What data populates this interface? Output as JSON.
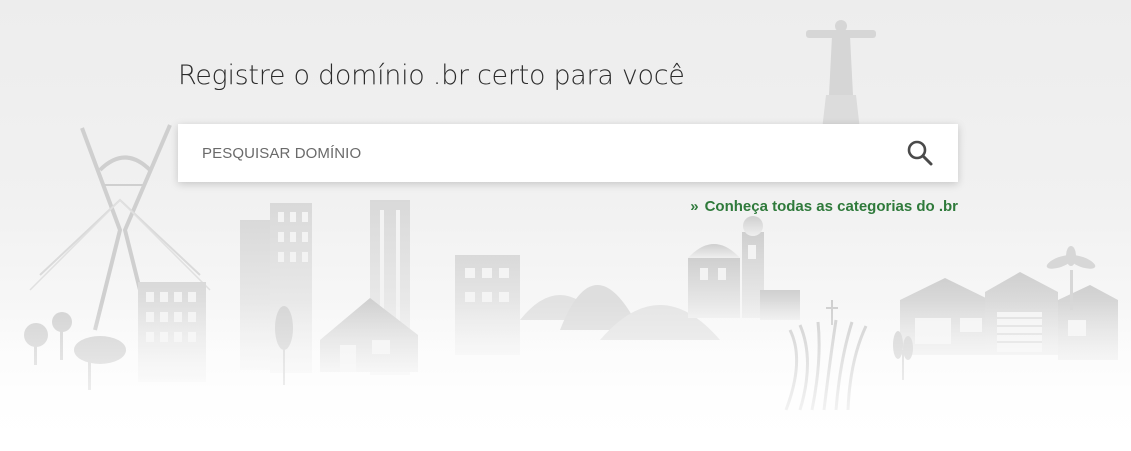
{
  "hero": {
    "title": "Registre o domínio .br certo para você"
  },
  "search": {
    "placeholder": "PESQUISAR DOMÍNIO",
    "icon": "search-icon"
  },
  "categories_link": {
    "prefix": "»",
    "label": "Conheça todas as categorias do .br",
    "color": "#2f7a3b"
  },
  "background": {
    "illustration": "brazil-landmarks-skyline",
    "tone": "#e0e0e0"
  }
}
